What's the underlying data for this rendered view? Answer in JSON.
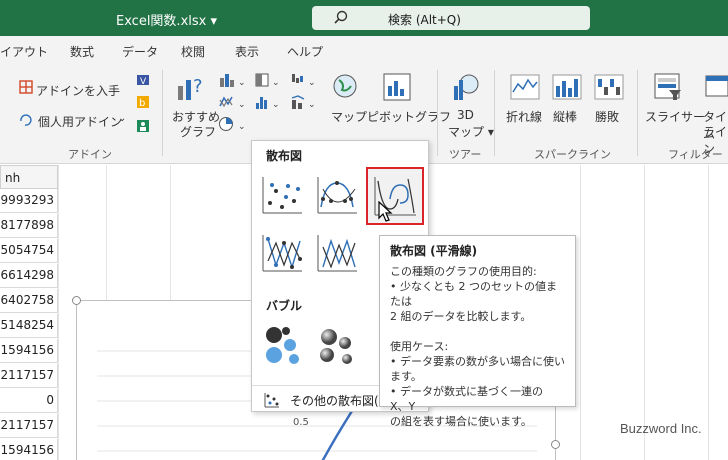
{
  "titlebar": {
    "filename": "Excel関数.xlsx ▾",
    "search_text": "検索 (Alt+Q)",
    "color": "#217346"
  },
  "tabs": [
    "イアウト",
    "数式",
    "データ",
    "校閲",
    "表示",
    "ヘルプ"
  ],
  "ribbon": {
    "addin_get": "アドインを入手",
    "addin_personal": "個人用アドイン",
    "recommended_1": "おすすめ",
    "recommended_2": "グラフ",
    "map": "マップ",
    "pivot": "ピボットグラフ",
    "map3d_1": "3D",
    "map3d_2": "マップ ▾",
    "line": "折れ線",
    "column": "縦棒",
    "winloss": "勝敗",
    "slicer": "スライサー",
    "timeline_1": "タイム",
    "timeline_2": "ライン",
    "groups": {
      "addin": "アドイン",
      "tour": "ツアー",
      "sparkline": "スパークライン",
      "filter": "フィルター"
    }
  },
  "sheet": {
    "column_header": "nh",
    "cells": [
      "9993293",
      "8177898",
      "5054754",
      "6614298",
      "6402758",
      "5148254",
      "1594156",
      "2117157",
      "0",
      "2117157",
      "1594156"
    ],
    "axis_tick": "0.5"
  },
  "dropdown": {
    "scatter_header": "散布図",
    "bubble_header": "バブル",
    "more_label": "その他の散布図(M)...",
    "selected_border": "#d9242a"
  },
  "tooltip": {
    "title": "散布図 (平滑線)",
    "lines_1": [
      "この種類のグラフの使用目的:",
      "• 少なくとも 2 つのセットの値または",
      "2 組のデータを比較します。"
    ],
    "lines_2": [
      "使用ケース:",
      "• データ要素の数が多い場合に使い",
      "ます。",
      "• データが数式に基づく一連の X、Y",
      "の組を表す場合に使います。"
    ]
  },
  "watermark": "Buzzword Inc."
}
